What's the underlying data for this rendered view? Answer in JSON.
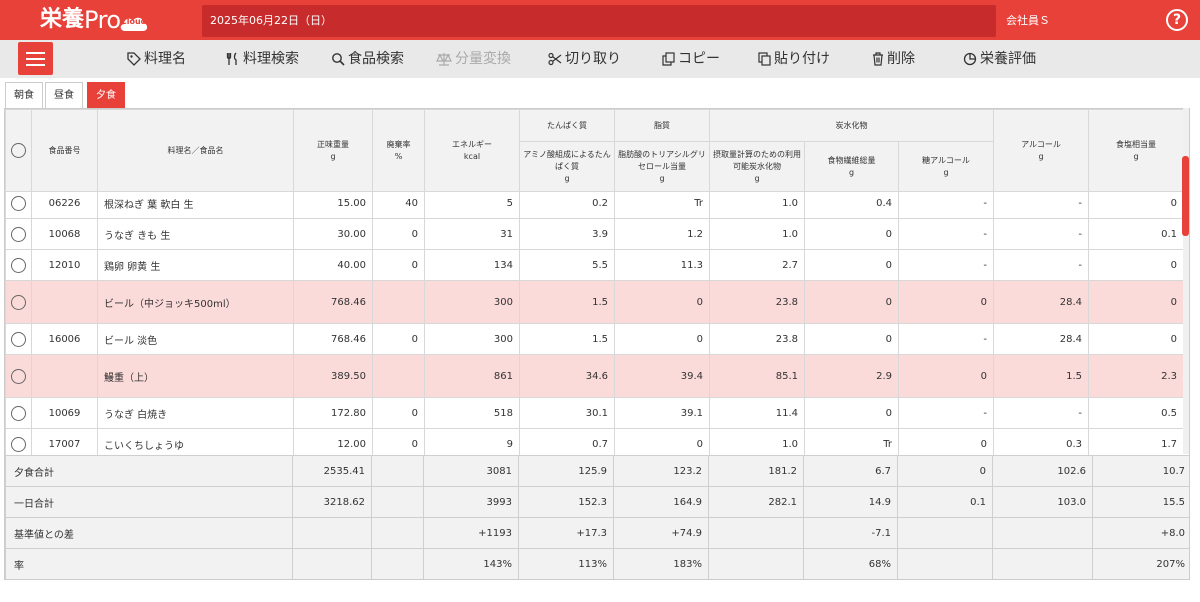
{
  "app": {
    "logo_jp": "栄養",
    "logo_pro": "Pro",
    "logo_cloud": "Cloud",
    "date": "2025年06月22日（日）",
    "user": "会社員Ｓ",
    "help_label": "?"
  },
  "toolbar": {
    "dish_name": "料理名",
    "dish_search": "料理検索",
    "food_search": "食品検索",
    "amount_convert": "分量変換",
    "cut": "切り取り",
    "copy": "コピー",
    "paste": "貼り付け",
    "delete": "削除",
    "nutrition_eval": "栄養評価"
  },
  "tabs": [
    "朝食",
    "昼食",
    "夕食"
  ],
  "columns": {
    "food_no": "食品番号",
    "name": "料理名／食品名",
    "net_weight": "正味重量",
    "net_weight_unit": "g",
    "waste_rate": "廃棄率",
    "waste_rate_unit": "%",
    "energy": "エネルギー",
    "energy_unit": "kcal",
    "protein_group": "たんぱく質",
    "protein_aa": "アミノ酸組成によるたんぱく質",
    "protein_aa_unit": "g",
    "fat_group": "脂質",
    "fat_tg": "脂肪酸のトリアシルグリセロール当量",
    "fat_tg_unit": "g",
    "carb_group": "炭水化物",
    "carb_available": "摂取量計算のための利用可能炭水化物",
    "carb_available_unit": "g",
    "fiber": "食物繊維総量",
    "fiber_unit": "g",
    "sugar_alcohol": "糖アルコール",
    "sugar_alcohol_unit": "g",
    "alcohol": "アルコール",
    "alcohol_unit": "g",
    "salt": "食塩相当量",
    "salt_unit": "g"
  },
  "rows": [
    {
      "code": "06226",
      "name": "根深ねぎ 葉 軟白 生",
      "net": "15.00",
      "waste": "40",
      "energy": "5",
      "protein": "0.2",
      "fat": "Tr",
      "carb": "1.0",
      "fiber": "0.4",
      "sugar_alc": "-",
      "alcohol": "-",
      "salt": "0",
      "dish": false
    },
    {
      "code": "10068",
      "name": "うなぎ きも 生",
      "net": "30.00",
      "waste": "0",
      "energy": "31",
      "protein": "3.9",
      "fat": "1.2",
      "carb": "1.0",
      "fiber": "0",
      "sugar_alc": "-",
      "alcohol": "-",
      "salt": "0.1",
      "dish": false
    },
    {
      "code": "12010",
      "name": "鶏卵 卵黄 生",
      "net": "40.00",
      "waste": "0",
      "energy": "134",
      "protein": "5.5",
      "fat": "11.3",
      "carb": "2.7",
      "fiber": "0",
      "sugar_alc": "-",
      "alcohol": "-",
      "salt": "0",
      "dish": false
    },
    {
      "code": "",
      "name": "ビール（中ジョッキ500ml）",
      "net": "768.46",
      "waste": "",
      "energy": "300",
      "protein": "1.5",
      "fat": "0",
      "carb": "23.8",
      "fiber": "0",
      "sugar_alc": "0",
      "alcohol": "28.4",
      "salt": "0",
      "dish": true
    },
    {
      "code": "16006",
      "name": "ビール 淡色",
      "net": "768.46",
      "waste": "0",
      "energy": "300",
      "protein": "1.5",
      "fat": "0",
      "carb": "23.8",
      "fiber": "0",
      "sugar_alc": "-",
      "alcohol": "28.4",
      "salt": "0",
      "dish": false
    },
    {
      "code": "",
      "name": "鰻重（上）",
      "net": "389.50",
      "waste": "",
      "energy": "861",
      "protein": "34.6",
      "fat": "39.4",
      "carb": "85.1",
      "fiber": "2.9",
      "sugar_alc": "0",
      "alcohol": "1.5",
      "salt": "2.3",
      "dish": true
    },
    {
      "code": "10069",
      "name": "うなぎ 白焼き",
      "net": "172.80",
      "waste": "0",
      "energy": "518",
      "protein": "30.1",
      "fat": "39.1",
      "carb": "11.4",
      "fiber": "0",
      "sugar_alc": "-",
      "alcohol": "-",
      "salt": "0.5",
      "dish": false
    },
    {
      "code": "17007",
      "name": "こいくちしょうゆ",
      "net": "12.00",
      "waste": "0",
      "energy": "9",
      "protein": "0.7",
      "fat": "0",
      "carb": "1.0",
      "fiber": "Tr",
      "sugar_alc": "0",
      "alcohol": "0.3",
      "salt": "1.7",
      "dish": false
    }
  ],
  "summary": [
    {
      "label": "夕食合計",
      "net": "2535.41",
      "energy": "3081",
      "protein": "125.9",
      "fat": "123.2",
      "carb": "181.2",
      "fiber": "6.7",
      "sugar_alc": "0",
      "alcohol": "102.6",
      "salt": "10.7"
    },
    {
      "label": "一日合計",
      "net": "3218.62",
      "energy": "3993",
      "protein": "152.3",
      "fat": "164.9",
      "carb": "282.1",
      "fiber": "14.9",
      "sugar_alc": "0.1",
      "alcohol": "103.0",
      "salt": "15.5"
    },
    {
      "label": "基準値との差",
      "net": "",
      "energy": "+1193",
      "protein": "+17.3",
      "fat": "+74.9",
      "carb": "",
      "fiber": "-7.1",
      "sugar_alc": "",
      "alcohol": "",
      "salt": "+8.0"
    },
    {
      "label": "率",
      "net": "",
      "energy": "143%",
      "protein": "113%",
      "fat": "183%",
      "carb": "",
      "fiber": "68%",
      "sugar_alc": "",
      "alcohol": "",
      "salt": "207%"
    }
  ],
  "colors": {
    "brand": "#e8413a",
    "dish_row": "#fbdada"
  }
}
